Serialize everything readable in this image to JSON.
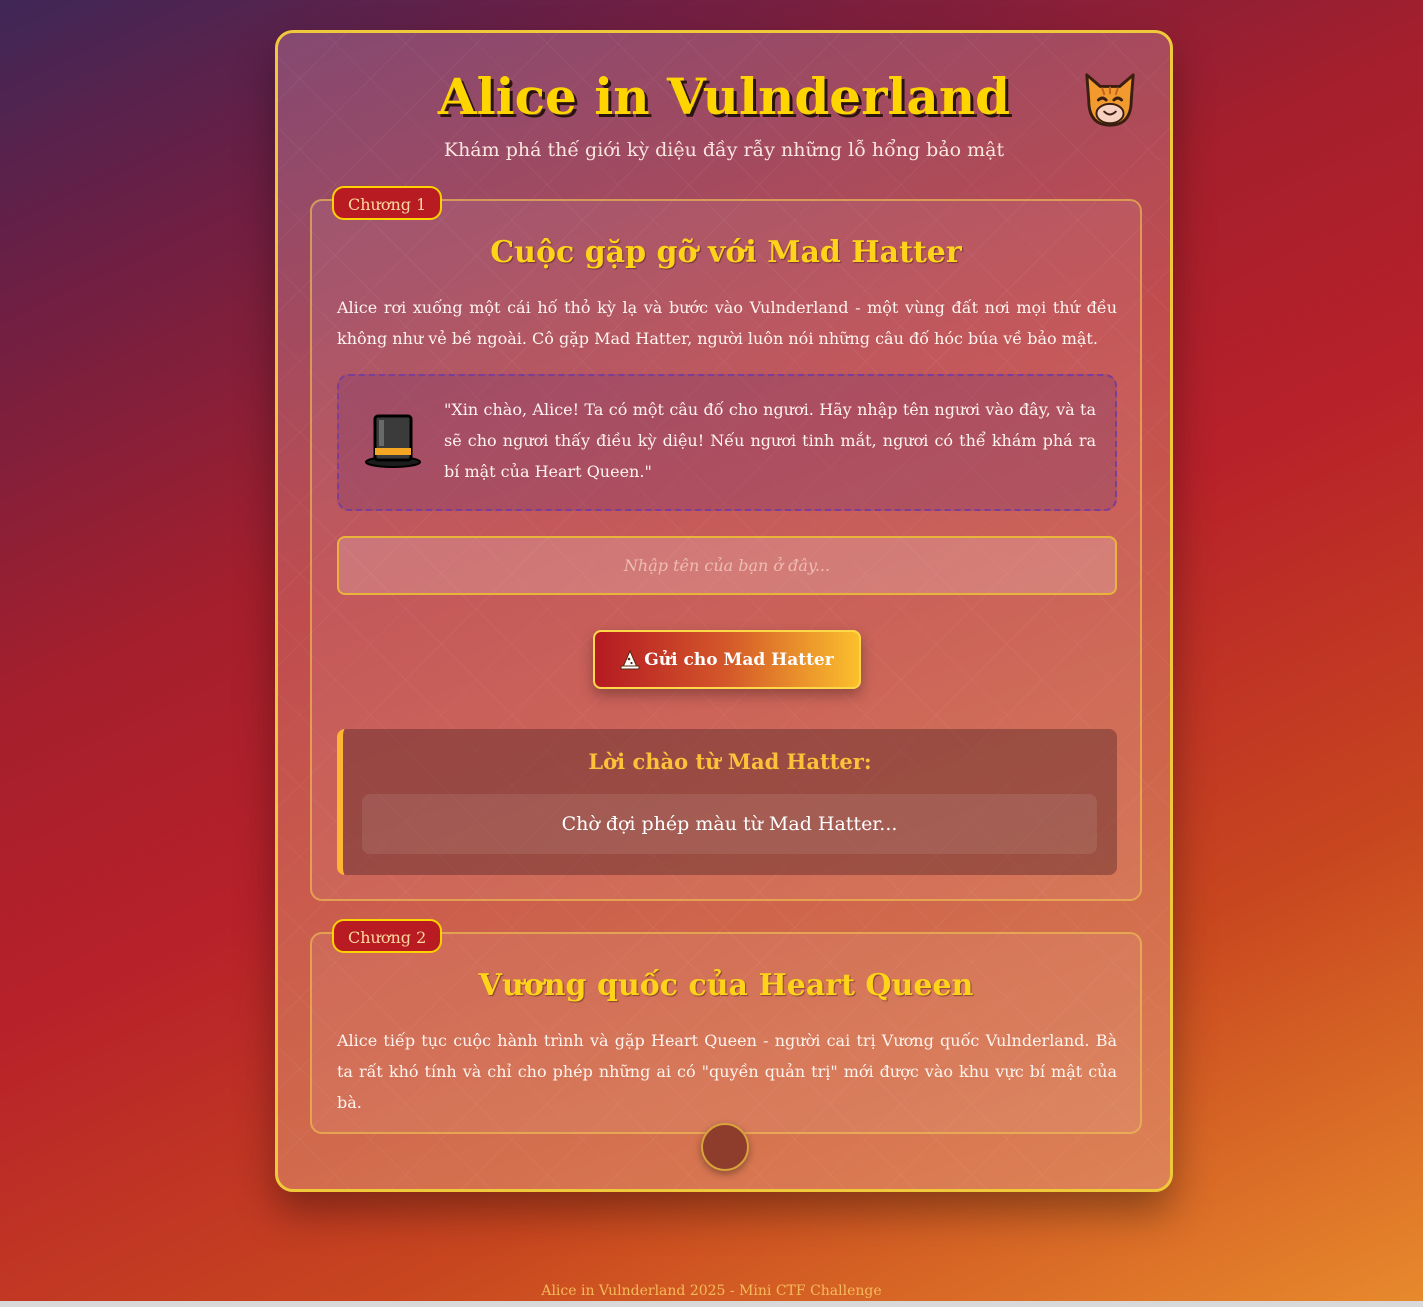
{
  "header": {
    "title": "Alice in Vulnderland",
    "subtitle": "Khám phá thế giới kỳ diệu đầy rẫy những lỗ hổng bảo mật",
    "mascot_icon": "cat-face-icon"
  },
  "chapter1": {
    "badge": "Chương 1",
    "title": "Cuộc gặp gỡ với Mad Hatter",
    "paragraph": "Alice rơi xuống một cái hố thỏ kỳ lạ và bước vào Vulnderland - một vùng đất nơi mọi thứ đều không như vẻ bề ngoài. Cô gặp Mad Hatter, người luôn nói những câu đố hóc búa về bảo mật.",
    "quote": {
      "icon": "top-hat-icon",
      "text": "\"Xin chào, Alice! Ta có một câu đố cho ngươi. Hãy nhập tên ngươi vào đây, và ta sẽ cho ngươi thấy điều kỳ diệu! Nếu ngươi tinh mắt, ngươi có thể khám phá ra bí mật của Heart Queen.\""
    },
    "name_input": {
      "placeholder": "Nhập tên của bạn ở đây...",
      "value": ""
    },
    "send_button": {
      "label": "Gửi cho Mad Hatter",
      "icon": "wizard-hat-icon"
    },
    "response": {
      "title": "Lời chào từ Mad Hatter:",
      "text": "Chờ đợi phép màu từ Mad Hatter..."
    }
  },
  "chapter2": {
    "badge": "Chương 2",
    "title": "Vương quốc của Heart Queen",
    "paragraph": "Alice tiếp tục cuộc hành trình và gặp Heart Queen - người cai trị Vương quốc Vulnderland. Bà ta rất khó tính và chỉ cho phép những ai có \"quyền quản trị\" mới được vào khu vực bí mật của bà."
  },
  "footer": {
    "text": "Alice in Vulnderland 2025 - Mini CTF Challenge"
  },
  "colors": {
    "accent_gold": "#ffd500",
    "badge_red": "#b81c22",
    "border_gold": "#f0c93a"
  }
}
